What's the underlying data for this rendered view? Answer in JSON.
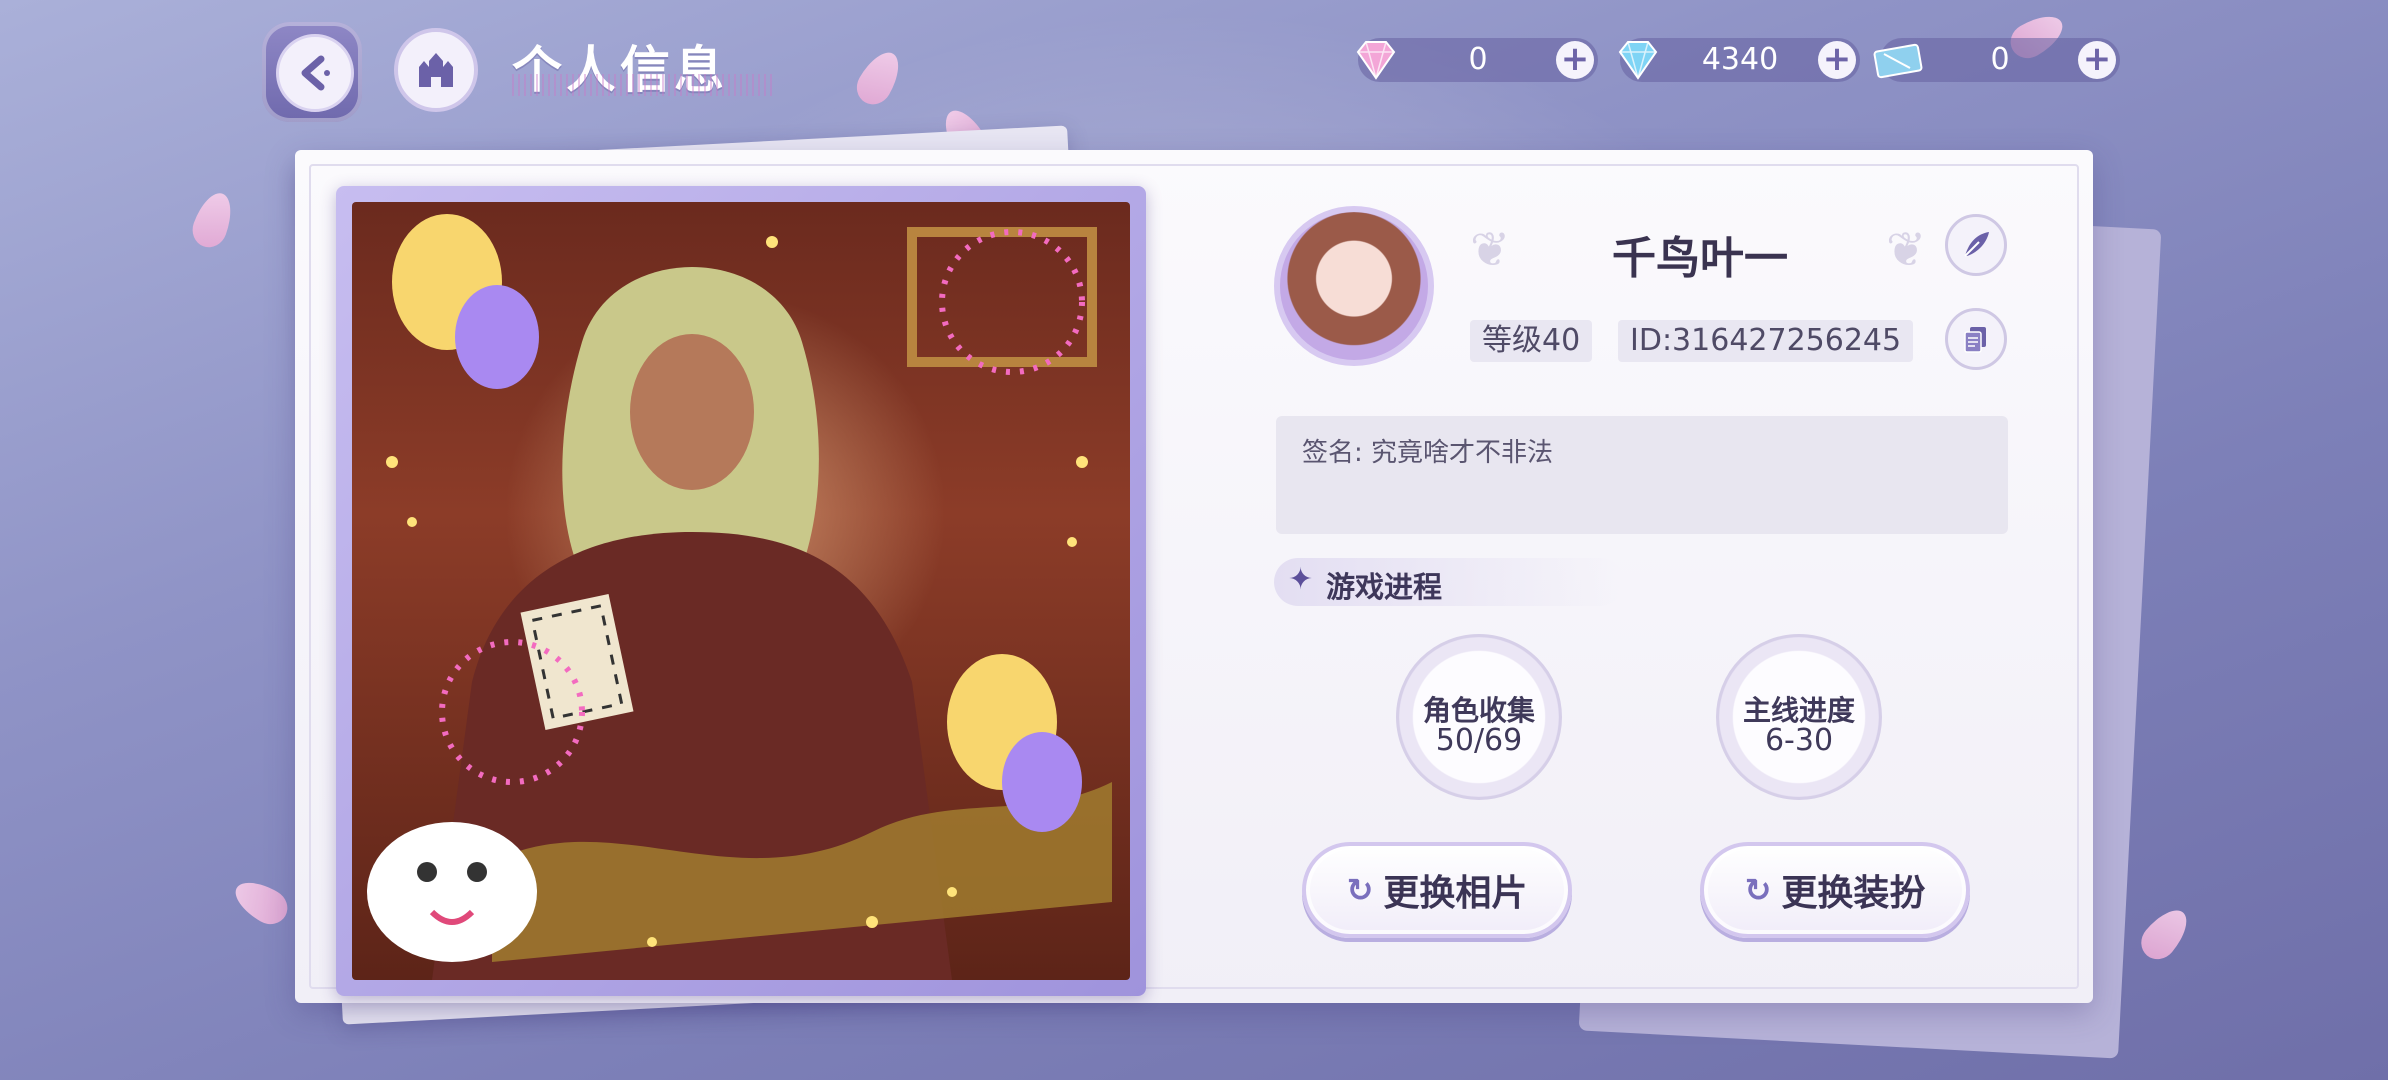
{
  "header": {
    "title": "个人信息",
    "back_icon": "back-arrow-icon",
    "home_icon": "castle-home-icon"
  },
  "currencies": [
    {
      "icon": "pink-diamond-icon",
      "value": "0"
    },
    {
      "icon": "blue-diamond-icon",
      "value": "4340"
    },
    {
      "icon": "ticket-icon",
      "value": "0"
    }
  ],
  "profile": {
    "name": "千鸟叶一",
    "level": "等级40",
    "id": "ID:316427256245",
    "signature_label": "签名:",
    "signature_text": "究竟啥才不非法"
  },
  "progress": {
    "section_title": "游戏进程",
    "items": [
      {
        "label": "角色收集",
        "value": "50/69"
      },
      {
        "label": "主线进度",
        "value": "6-30"
      }
    ]
  },
  "actions": {
    "change_photo": "更换相片",
    "change_outfit": "更换装扮"
  },
  "colors": {
    "accent": "#6d64a8",
    "panel_bg": "#f6f4fb",
    "background": "#8f93c6"
  }
}
